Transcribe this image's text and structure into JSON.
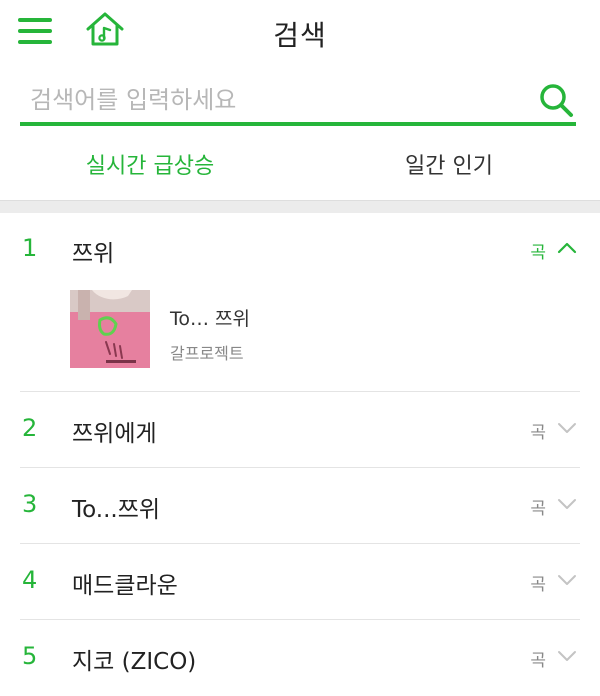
{
  "header": {
    "title": "검색",
    "menu_icon": "hamburger-menu-icon",
    "home_icon": "home-music-icon",
    "accent_color": "#26b53a"
  },
  "search": {
    "placeholder": "검색어를 입력하세요",
    "value": "",
    "icon": "search-icon"
  },
  "tabs": [
    {
      "label": "실시간 급상승",
      "active": true
    },
    {
      "label": "일간 인기",
      "active": false
    }
  ],
  "results": [
    {
      "rank": "1",
      "keyword": "쯔위",
      "type": "곡",
      "expanded": true,
      "song": {
        "title": "To… 쯔위",
        "artist": "갈프로젝트"
      }
    },
    {
      "rank": "2",
      "keyword": "쯔위에게",
      "type": "곡",
      "expanded": false
    },
    {
      "rank": "3",
      "keyword": "To...쯔위",
      "type": "곡",
      "expanded": false
    },
    {
      "rank": "4",
      "keyword": "매드클라운",
      "type": "곡",
      "expanded": false
    },
    {
      "rank": "5",
      "keyword": "지코 (ZICO)",
      "type": "곡",
      "expanded": false
    }
  ]
}
